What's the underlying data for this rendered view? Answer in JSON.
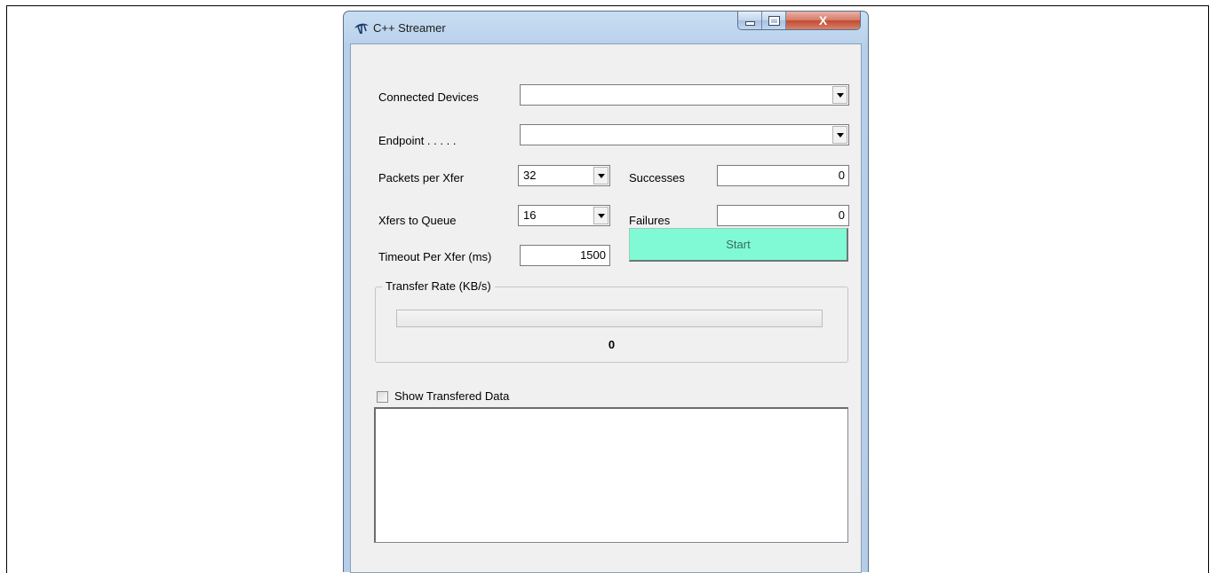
{
  "window": {
    "title": "C++ Streamer"
  },
  "title_controls": {
    "close": "X"
  },
  "form": {
    "connected_devices_label": "Connected Devices",
    "connected_devices_value": "",
    "endpoint_label": "Endpoint . . . . .",
    "endpoint_value": "",
    "packets_label": "Packets per Xfer",
    "packets_value": "32",
    "xfers_label": "Xfers to Queue",
    "xfers_value": "16",
    "timeout_label": "Timeout Per Xfer (ms)",
    "timeout_value": "1500",
    "successes_label": "Successes",
    "successes_value": "0",
    "failures_label": "Failures",
    "failures_value": "0",
    "start_label": "Start"
  },
  "transfer": {
    "group_label": "Transfer Rate (KB/s)",
    "rate_value": "0",
    "progress_fraction": 0
  },
  "show_data": {
    "label": "Show Transfered Data",
    "checked": false,
    "text": ""
  },
  "colors": {
    "start_button": "#7ffad4",
    "window_frame": "#b7d0ea",
    "client_bg": "#f0f0f0"
  }
}
